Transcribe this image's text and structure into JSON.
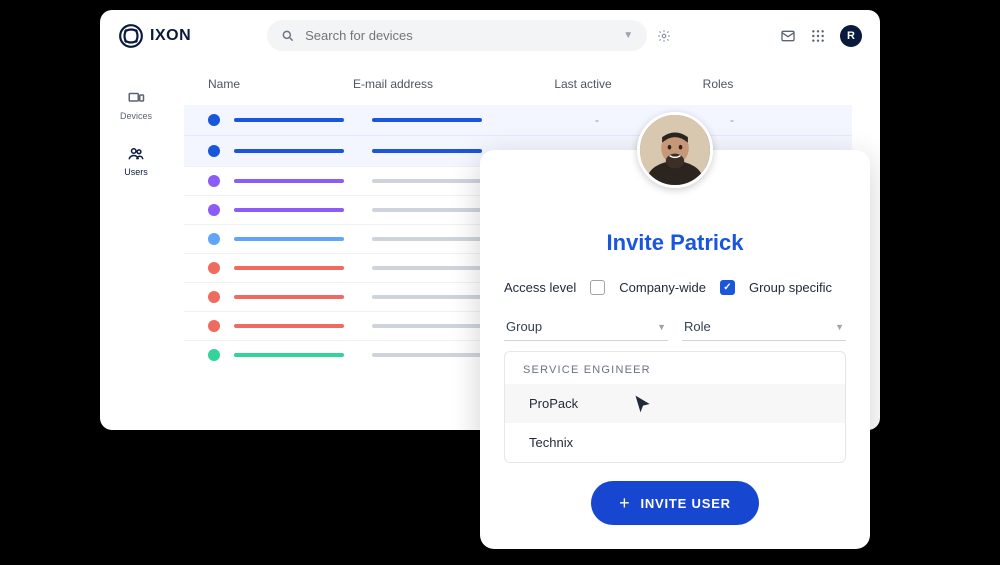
{
  "brand": "IXON",
  "search": {
    "placeholder": "Search for devices"
  },
  "header": {
    "avatar_initial": "R"
  },
  "sidebar": {
    "items": [
      {
        "label": "Devices"
      },
      {
        "label": "Users"
      }
    ]
  },
  "table": {
    "columns": {
      "name": "Name",
      "email": "E-mail address",
      "last_active": "Last active",
      "roles": "Roles"
    },
    "rows": [
      {
        "color": "blue",
        "selected": true,
        "last_active": "-",
        "roles": "-"
      },
      {
        "color": "blue",
        "selected": true,
        "last_active": "-",
        "roles": "-"
      },
      {
        "color": "purple",
        "selected": false,
        "last_active": "",
        "roles": ""
      },
      {
        "color": "purple",
        "selected": false,
        "last_active": "",
        "roles": ""
      },
      {
        "color": "lightblue",
        "selected": false,
        "last_active": "",
        "roles": ""
      },
      {
        "color": "red",
        "selected": false,
        "last_active": "",
        "roles": ""
      },
      {
        "color": "red",
        "selected": false,
        "last_active": "",
        "roles": ""
      },
      {
        "color": "red",
        "selected": false,
        "last_active": "",
        "roles": ""
      },
      {
        "color": "green",
        "selected": false,
        "last_active": "",
        "roles": ""
      }
    ]
  },
  "invite": {
    "title": "Invite Patrick",
    "access_label": "Access level",
    "company_wide": {
      "label": "Company-wide",
      "checked": false
    },
    "group_specific": {
      "label": "Group specific",
      "checked": true
    },
    "group_label": "Group",
    "role_label": "Role",
    "dropdown": {
      "section": "SERVICE ENGINEER",
      "items": [
        "ProPack",
        "Technix"
      ]
    },
    "button": "INVITE USER"
  }
}
